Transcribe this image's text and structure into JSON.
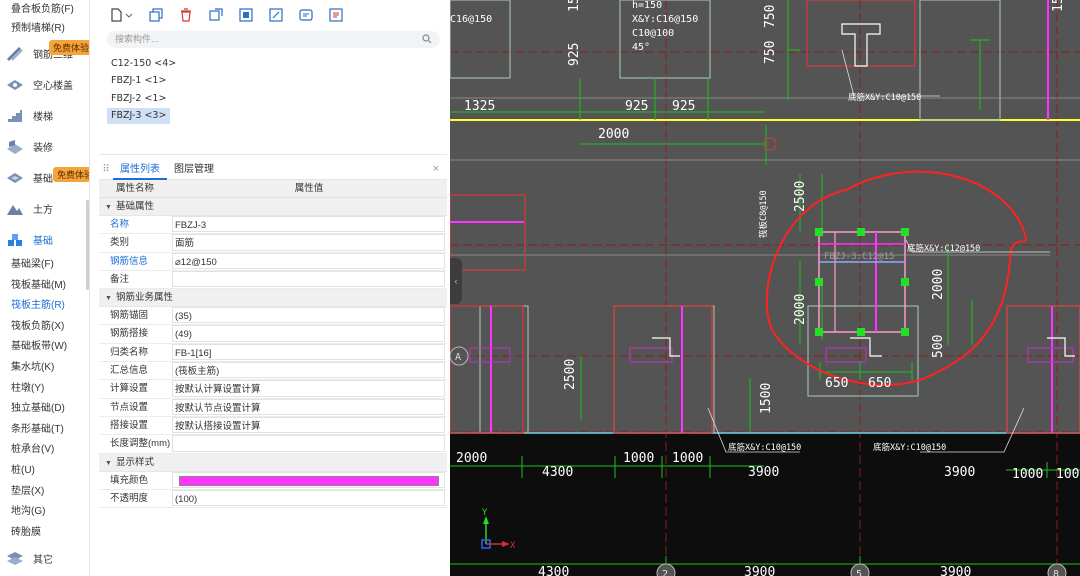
{
  "nav": {
    "top": [
      "叠合板负筋(F)",
      "预制墙梯(R)"
    ],
    "groups": [
      {
        "label": "钢筋三维",
        "icon": "rebar-icon",
        "badge": "免费体验"
      },
      {
        "label": "空心楼盖",
        "icon": "hollow-slab-icon"
      },
      {
        "label": "楼梯",
        "icon": "stair-icon"
      },
      {
        "label": "装修",
        "icon": "decoration-icon"
      },
      {
        "label": "基础",
        "icon": "foundation-pit-icon",
        "badge": "免费体验"
      },
      {
        "label": "土方",
        "icon": "earthwork-icon"
      },
      {
        "label": "基础",
        "icon": "foundation-icon",
        "active": true
      }
    ],
    "sub_items": [
      "基础梁(F)",
      "筏板基础(M)",
      "筏板主筋(R)",
      "筏板负筋(X)",
      "基础板带(W)",
      "集水坑(K)",
      "柱墩(Y)",
      "独立基础(D)",
      "条形基础(T)",
      "桩承台(V)",
      "桩(U)",
      "垫层(X)",
      "地沟(G)",
      "砖胎膜"
    ],
    "selected_sub": 2,
    "bottom": {
      "label": "其它",
      "icon": "other-icon"
    }
  },
  "components": {
    "search_placeholder": "搜索构件...",
    "items": [
      "C12-150 <4>",
      "FBZJ-1 <1>",
      "FBZJ-2 <1>",
      "FBZJ-3 <3>"
    ],
    "selected": 3,
    "toolbar": [
      "new-icon",
      "dropdown-icon",
      "copy-icon",
      "delete-icon",
      "copy-to-floor-icon",
      "floor-import-icon",
      "layer-copy-icon",
      "define-icon",
      "property-icon"
    ]
  },
  "properties": {
    "tabs": [
      "属性列表",
      "图层管理"
    ],
    "active_tab": 0,
    "col_name": "属性名称",
    "col_value": "属性值",
    "sections": [
      {
        "title": "基础属性",
        "rows": [
          {
            "k": "名称",
            "v": "FBZJ-3",
            "blue": true
          },
          {
            "k": "类别",
            "v": "面筋"
          },
          {
            "k": "钢筋信息",
            "v": "⌀12@150",
            "blue": true
          },
          {
            "k": "备注",
            "v": ""
          }
        ]
      },
      {
        "title": "钢筋业务属性",
        "rows": [
          {
            "k": "钢筋锚固",
            "v": "(35)"
          },
          {
            "k": "钢筋搭接",
            "v": "(49)"
          },
          {
            "k": "归类名称",
            "v": "FB-1[16]"
          },
          {
            "k": "汇总信息",
            "v": "(筏板主筋)"
          },
          {
            "k": "计算设置",
            "v": "按默认计算设置计算"
          },
          {
            "k": "节点设置",
            "v": "按默认节点设置计算"
          },
          {
            "k": "搭接设置",
            "v": "按默认搭接设置计算"
          },
          {
            "k": "长度调整(mm)",
            "v": ""
          }
        ]
      },
      {
        "title": "显示样式",
        "rows": [
          {
            "k": "填充颜色",
            "v": "",
            "swatch": "#ff33ff"
          },
          {
            "k": "不透明度",
            "v": "(100)"
          }
        ]
      }
    ]
  },
  "cad": {
    "colors": {
      "bg": "#545454",
      "grid": "#8c1c1c",
      "dim": "#19c219",
      "text": "#ffffff",
      "beam": "#d03a3a",
      "magenta": "#ff33ff",
      "yellow": "#ffff33",
      "annotation": "#ff2222"
    },
    "texts": {
      "rebar_top": "h=150",
      "rebar_top2": "X&Y:C16@150",
      "rebar_top3": "C10@100",
      "rebar_top4": "45°",
      "rebar_top0": "C16@150",
      "label_topright": "底筋X&Y:C10@150",
      "label_center": "底筋X&Y:C12@150",
      "label_selected": "FBZJ-3:C12@15",
      "label_bottom1": "底筋X&Y:C10@150",
      "label_bottom2": "底筋X&Y:C10@150",
      "label_vertical": "筏板C8@150",
      "axis_a": "A",
      "axis_2": "2",
      "axis_5": "5",
      "axis_8": "8",
      "ucs_y": "Y",
      "ucs_x": "X"
    },
    "dims": [
      "1325",
      "925",
      "925",
      "2000",
      "925",
      "750",
      "750",
      "15",
      "15",
      "2500",
      "2000",
      "2000",
      "500",
      "650",
      "650",
      "2500",
      "1500",
      "2000",
      "4300",
      "1000",
      "1000",
      "3900",
      "3900",
      "1000",
      "1000",
      "4300",
      "3900",
      "3900"
    ]
  }
}
